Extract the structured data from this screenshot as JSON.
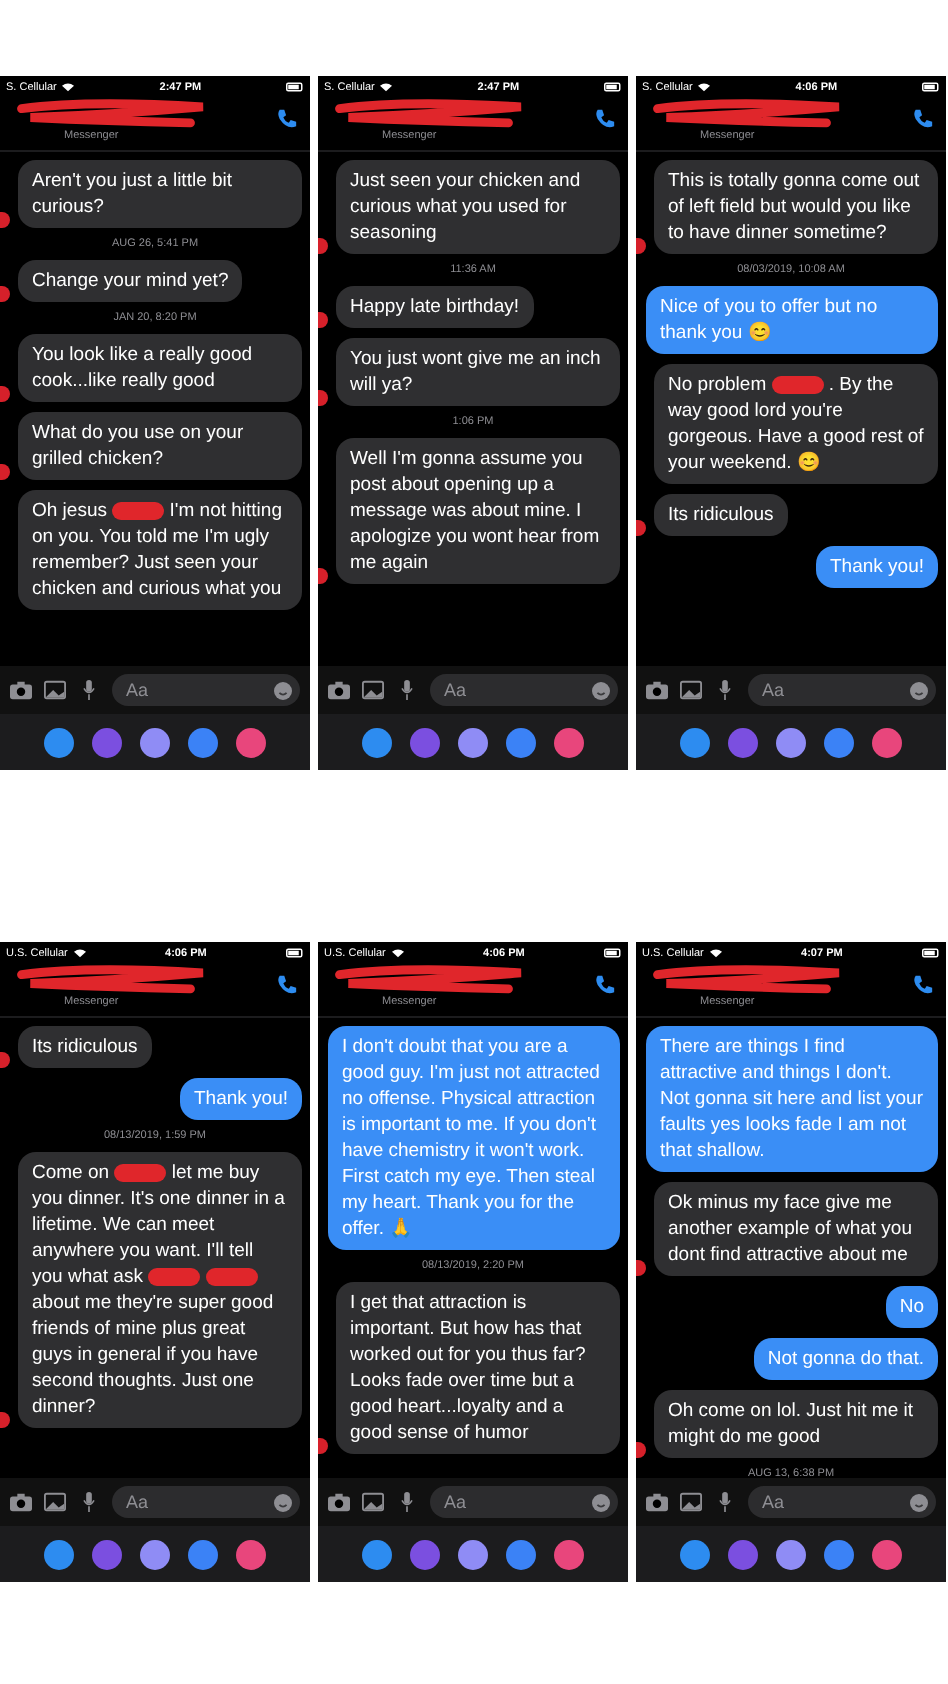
{
  "screenshots": [
    {
      "carrier": "S. Cellular",
      "time": "2:47 PM",
      "subtitle": "Messenger",
      "placeholder": "Aa",
      "messages": [
        {
          "kind": "incoming",
          "avatar_redacted": true,
          "parts": [
            {
              "kind": "text",
              "text": "Aren't you just a little bit curious?"
            }
          ]
        },
        {
          "kind": "timestamp",
          "text": "AUG 26, 5:41 PM"
        },
        {
          "kind": "incoming",
          "avatar_redacted": true,
          "parts": [
            {
              "kind": "text",
              "text": "Change your mind yet?"
            }
          ]
        },
        {
          "kind": "timestamp",
          "text": "JAN 20, 8:20 PM"
        },
        {
          "kind": "incoming",
          "avatar_redacted": true,
          "parts": [
            {
              "kind": "text",
              "text": "You look like a really good cook...like really good"
            }
          ]
        },
        {
          "kind": "incoming",
          "avatar_redacted": true,
          "parts": [
            {
              "kind": "text",
              "text": "What do you use on your grilled chicken?"
            }
          ]
        },
        {
          "kind": "incoming",
          "avatar_redacted": false,
          "parts": [
            {
              "kind": "text",
              "text": "Oh jesus"
            },
            {
              "kind": "redaction"
            },
            {
              "kind": "text",
              "text": "I'm not hitting on you.  You told me I'm ugly remember? Just seen your chicken and curious what you"
            }
          ]
        }
      ]
    },
    {
      "carrier": "S. Cellular",
      "time": "2:47 PM",
      "subtitle": "Messenger",
      "placeholder": "Aa",
      "messages": [
        {
          "kind": "incoming",
          "avatar_redacted": true,
          "parts": [
            {
              "kind": "text",
              "text": "Just seen your chicken and curious what you used for seasoning"
            }
          ]
        },
        {
          "kind": "timestamp",
          "text": "11:36 AM"
        },
        {
          "kind": "incoming",
          "avatar_redacted": true,
          "parts": [
            {
              "kind": "text",
              "text": "Happy late birthday!"
            }
          ]
        },
        {
          "kind": "incoming",
          "avatar_redacted": true,
          "parts": [
            {
              "kind": "text",
              "text": "You just wont give me an inch will ya?"
            }
          ]
        },
        {
          "kind": "timestamp",
          "text": "1:06 PM"
        },
        {
          "kind": "incoming",
          "avatar_redacted": true,
          "parts": [
            {
              "kind": "text",
              "text": "Well I'm gonna assume you post about opening up a message was about mine. I apologize you wont hear from me again"
            }
          ]
        }
      ]
    },
    {
      "carrier": "S. Cellular",
      "time": "4:06 PM",
      "subtitle": "Messenger",
      "placeholder": "Aa",
      "messages": [
        {
          "kind": "incoming",
          "avatar_redacted": true,
          "parts": [
            {
              "kind": "text",
              "text": "This is totally gonna come out of left field but would you like to have dinner sometime?"
            }
          ]
        },
        {
          "kind": "timestamp",
          "text": "08/03/2019, 10:08 AM"
        },
        {
          "kind": "outgoing",
          "parts": [
            {
              "kind": "text",
              "text": "Nice of you to offer but no thank you 😊"
            }
          ]
        },
        {
          "kind": "incoming",
          "avatar_redacted": false,
          "parts": [
            {
              "kind": "text",
              "text": "No problem"
            },
            {
              "kind": "redaction"
            },
            {
              "kind": "text",
              "text": ". By the way good lord you're gorgeous. Have a good rest of your weekend. 😊"
            }
          ]
        },
        {
          "kind": "incoming",
          "avatar_redacted": true,
          "parts": [
            {
              "kind": "text",
              "text": "Its ridiculous"
            }
          ]
        },
        {
          "kind": "outgoing",
          "parts": [
            {
              "kind": "text",
              "text": "Thank you!"
            }
          ]
        }
      ]
    },
    {
      "carrier": "U.S. Cellular",
      "time": "4:06 PM",
      "subtitle": "Messenger",
      "placeholder": "Aa",
      "messages": [
        {
          "kind": "incoming",
          "avatar_redacted": true,
          "parts": [
            {
              "kind": "text",
              "text": "Its ridiculous"
            }
          ]
        },
        {
          "kind": "outgoing",
          "parts": [
            {
              "kind": "text",
              "text": "Thank you!"
            }
          ]
        },
        {
          "kind": "timestamp",
          "text": "08/13/2019, 1:59 PM"
        },
        {
          "kind": "incoming",
          "avatar_redacted": true,
          "parts": [
            {
              "kind": "text",
              "text": "Come on"
            },
            {
              "kind": "redaction"
            },
            {
              "kind": "text",
              "text": "let me buy you dinner. It's one dinner in a lifetime. We can meet anywhere you want. I'll tell you what ask"
            },
            {
              "kind": "redaction"
            },
            {
              "kind": "redaction"
            },
            {
              "kind": "text",
              "text": "about me they're super good friends of mine plus great guys in general if you have second thoughts. Just one dinner?"
            }
          ]
        }
      ]
    },
    {
      "carrier": "U.S. Cellular",
      "time": "4:06 PM",
      "subtitle": "Messenger",
      "placeholder": "Aa",
      "messages": [
        {
          "kind": "outgoing",
          "parts": [
            {
              "kind": "text",
              "text": "I don't doubt that you are a good guy. I'm just not attracted no offense. Physical attraction is important to me. If you don't have chemistry it won't work.  First catch my eye. Then steal my heart. Thank you for the offer. 🙏"
            }
          ]
        },
        {
          "kind": "timestamp",
          "text": "08/13/2019, 2:20 PM"
        },
        {
          "kind": "incoming",
          "avatar_redacted": true,
          "parts": [
            {
              "kind": "text",
              "text": "I get that attraction is important. But how has that worked out for you thus far? Looks fade over time but a good heart...loyalty and a good sense of humor"
            }
          ]
        }
      ]
    },
    {
      "carrier": "U.S. Cellular",
      "time": "4:07 PM",
      "subtitle": "Messenger",
      "placeholder": "Aa",
      "messages": [
        {
          "kind": "outgoing",
          "parts": [
            {
              "kind": "text",
              "text": "There are things I find attractive and things I don't. Not gonna sit here and list your faults yes looks fade I am not that shallow."
            }
          ]
        },
        {
          "kind": "incoming",
          "avatar_redacted": true,
          "parts": [
            {
              "kind": "text",
              "text": "Ok minus my face give me another example of what you dont find attractive about me"
            }
          ]
        },
        {
          "kind": "outgoing",
          "parts": [
            {
              "kind": "text",
              "text": "No"
            }
          ]
        },
        {
          "kind": "outgoing",
          "parts": [
            {
              "kind": "text",
              "text": "Not gonna do that."
            }
          ]
        },
        {
          "kind": "incoming",
          "avatar_redacted": true,
          "parts": [
            {
              "kind": "text",
              "text": "Oh come on lol. Just hit me it might do me good"
            }
          ]
        },
        {
          "kind": "timestamp",
          "text": "AUG 13, 6:38 PM"
        }
      ]
    }
  ]
}
